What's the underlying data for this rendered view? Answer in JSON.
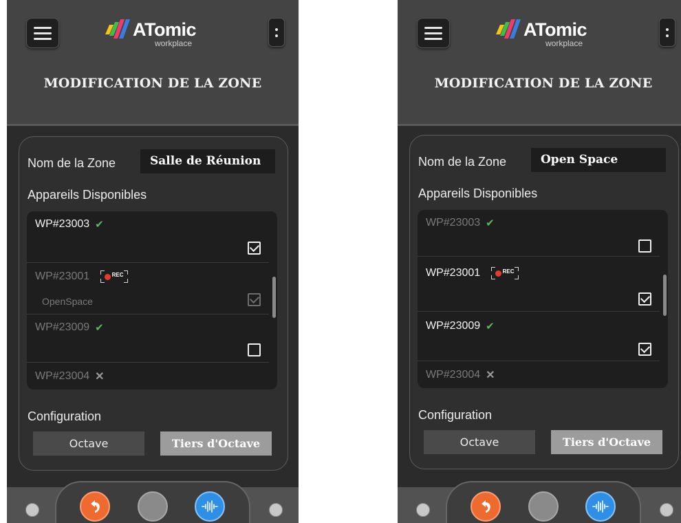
{
  "logo": {
    "brand": "ATomic",
    "sub": "workplace"
  },
  "screens": [
    {
      "title": "MODIFICATION DE LA ZONE",
      "zone_label": "Nom de la Zone",
      "zone_name": "Salle de Réunion",
      "available_label": "Appareils Disponibles",
      "devices": [
        {
          "id": "WP#23003",
          "status": "ok-check",
          "checked": true,
          "enabled": true,
          "sub": ""
        },
        {
          "id": "WP#23001",
          "status": "rec",
          "checked": true,
          "enabled": false,
          "sub": "OpenSpace"
        },
        {
          "id": "WP#23009",
          "status": "ok-check",
          "checked": false,
          "enabled": false,
          "sub": ""
        },
        {
          "id": "WP#23004",
          "status": "error-x",
          "checked": false,
          "enabled": false,
          "sub": ""
        }
      ],
      "config_label": "Configuration",
      "config_options": [
        "Octave",
        "Tiers d'Octave"
      ],
      "config_selected": "Tiers d'Octave"
    },
    {
      "title": "MODIFICATION DE LA ZONE",
      "zone_label": "Nom de la Zone",
      "zone_name": "Open Space",
      "available_label": "Appareils Disponibles",
      "devices": [
        {
          "id": "WP#23003",
          "status": "ok-check",
          "checked": false,
          "enabled": false,
          "sub": ""
        },
        {
          "id": "WP#23001",
          "status": "rec",
          "checked": true,
          "enabled": true,
          "sub": ""
        },
        {
          "id": "WP#23009",
          "status": "ok-check",
          "checked": true,
          "enabled": true,
          "sub": ""
        },
        {
          "id": "WP#23004",
          "status": "error-x",
          "checked": false,
          "enabled": false,
          "sub": ""
        }
      ],
      "config_label": "Configuration",
      "config_options": [
        "Octave",
        "Tiers d'Octave"
      ],
      "config_selected": "Tiers d'Octave"
    }
  ],
  "icons": {
    "ok": "check-icon",
    "error": "cross-icon",
    "rec": "rec-badge-icon",
    "menu": "hamburger-icon",
    "more": "kebab-menu-icon",
    "undo": "undo-icon",
    "home": "home-circle-icon",
    "audio": "audio-wave-icon"
  },
  "rec_text": "REC",
  "colors": {
    "ok_green": "#5cb85c",
    "rec_red": "#e53b2c",
    "undo_orange": "#ef6a2e",
    "audio_blue": "#2f8fe6"
  }
}
